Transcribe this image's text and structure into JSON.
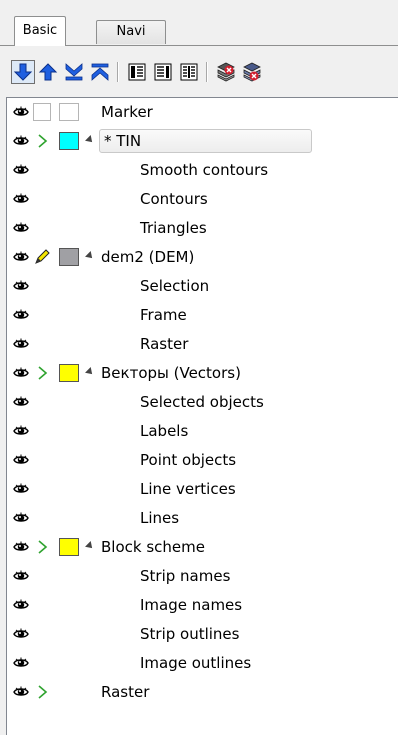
{
  "tabs": [
    {
      "label": "Basic",
      "active": true
    },
    {
      "label": "Navi",
      "active": false
    }
  ],
  "toolbar": {
    "buttons": [
      {
        "icon": "move-down-icon",
        "color": "#1f5fe0"
      },
      {
        "icon": "move-up-icon",
        "color": "#1f5fe0"
      },
      {
        "icon": "move-to-bottom-icon",
        "color": "#1f5fe0"
      },
      {
        "icon": "move-to-top-icon",
        "color": "#1f5fe0"
      },
      {
        "icon": "list-view-icon"
      },
      {
        "icon": "detail-view-icon"
      },
      {
        "icon": "columns-view-icon"
      },
      {
        "icon": "remove-layer-icon",
        "color": "#d2202f"
      },
      {
        "icon": "delete-layer-icon",
        "color": "#d2202f"
      }
    ]
  },
  "layers": [
    {
      "label": "Marker",
      "level": 0,
      "state": "empty",
      "swatch": "#ffffff",
      "swatch_border": "#b5b5b5",
      "expanded": null
    },
    {
      "label": "* TIN",
      "level": 0,
      "state": "arrow",
      "swatch": "#00ffff",
      "expanded": true,
      "selected": true
    },
    {
      "label": "Smooth contours",
      "level": 1
    },
    {
      "label": "Contours",
      "level": 1
    },
    {
      "label": "Triangles",
      "level": 1
    },
    {
      "label": "dem2 (DEM)",
      "level": 0,
      "state": "pencil",
      "swatch": "#a0a0a4",
      "expanded": true
    },
    {
      "label": "Selection",
      "level": 1
    },
    {
      "label": "Frame",
      "level": 1
    },
    {
      "label": "Raster",
      "level": 1
    },
    {
      "label": "Векторы (Vectors)",
      "level": 0,
      "state": "arrow",
      "swatch": "#ffff00",
      "expanded": true
    },
    {
      "label": "Selected objects",
      "level": 1
    },
    {
      "label": "Labels",
      "level": 1
    },
    {
      "label": "Point objects",
      "level": 1
    },
    {
      "label": "Line vertices",
      "level": 1
    },
    {
      "label": "Lines",
      "level": 1
    },
    {
      "label": "Block scheme",
      "level": 0,
      "state": "arrow",
      "swatch": "#ffff00",
      "expanded": true
    },
    {
      "label": "Strip names",
      "level": 1
    },
    {
      "label": "Image names",
      "level": 1
    },
    {
      "label": "Strip outlines",
      "level": 1
    },
    {
      "label": "Image outlines",
      "level": 1
    },
    {
      "label": "Raster",
      "level": 0,
      "state": "arrow",
      "swatch": null,
      "expanded": null
    }
  ],
  "colors": {
    "arrow_green": "#2fa32f",
    "eye": "#000000",
    "tree_bg": "#ffffff"
  }
}
